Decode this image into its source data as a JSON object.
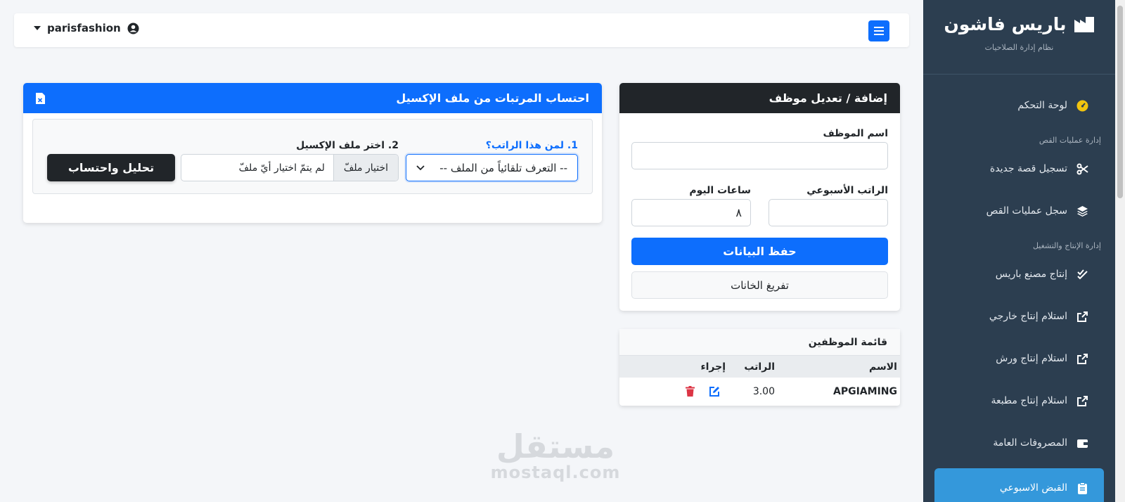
{
  "sidebar": {
    "brand_title": "باريس فاشون",
    "brand_subtitle": "نظام إدارة الصلاحيات",
    "items": [
      {
        "label": "لوحة التحكم",
        "icon": "gauge-icon"
      },
      {
        "header": "إدارة عمليات القص"
      },
      {
        "label": "تسجيل قصة جديدة",
        "icon": "scissors-icon"
      },
      {
        "label": "سجل عمليات القص",
        "icon": "layers-icon"
      },
      {
        "header": "إدارة الإنتاج والتشغيل"
      },
      {
        "label": "إنتاج مصنع باريس",
        "icon": "double-check-icon"
      },
      {
        "label": "استلام إنتاج خارجي",
        "icon": "external-link-icon"
      },
      {
        "label": "استلام إنتاج ورش",
        "icon": "external-link-icon"
      },
      {
        "label": "استلام إنتاج مطبعة",
        "icon": "external-link-icon"
      },
      {
        "label": "المصروفات العامة",
        "icon": "wallet-icon"
      },
      {
        "label": "القبض الاسبوعي",
        "icon": "clipboard-icon",
        "active": true
      }
    ]
  },
  "topbar": {
    "username": "parisfashion"
  },
  "employee_form": {
    "title": "إضافة / تعديل موظف",
    "name_label": "اسم الموظف",
    "name_value": "",
    "weekly_salary_label": "الراتب الأسبوعي",
    "weekly_salary_value": "",
    "day_hours_label": "ساعات اليوم",
    "day_hours_value": "٨",
    "save_label": "حفظ البيانات",
    "clear_label": "تفريغ الخانات"
  },
  "employee_list": {
    "title": "قائمة الموظفين",
    "columns": {
      "name": "الاسم",
      "salary": "الراتب",
      "action": "إجراء"
    },
    "rows": [
      {
        "name": "APGIAMING",
        "salary": "3.00"
      }
    ]
  },
  "salary_calc": {
    "title": "احتساب المرتبات من ملف الإكسيل",
    "step1_label": "1. لمن هذا الراتب؟",
    "select_value": "-- التعرف تلقائياً من الملف --",
    "step2_label": "2. اختر ملف الإكسيل",
    "file_button": "اختيار ملفّ",
    "file_status": "لم يتمّ اختيار أيّ ملفّ",
    "analyze_label": "تحليل واحتساب"
  },
  "watermark": {
    "arabic": "مستقل",
    "latin": "mostaql.com"
  },
  "colors": {
    "sidebar_bg": "#2c3e50",
    "primary": "#0d6efd",
    "dark": "#212529",
    "danger": "#dc3545",
    "active_item": "#3498db"
  }
}
